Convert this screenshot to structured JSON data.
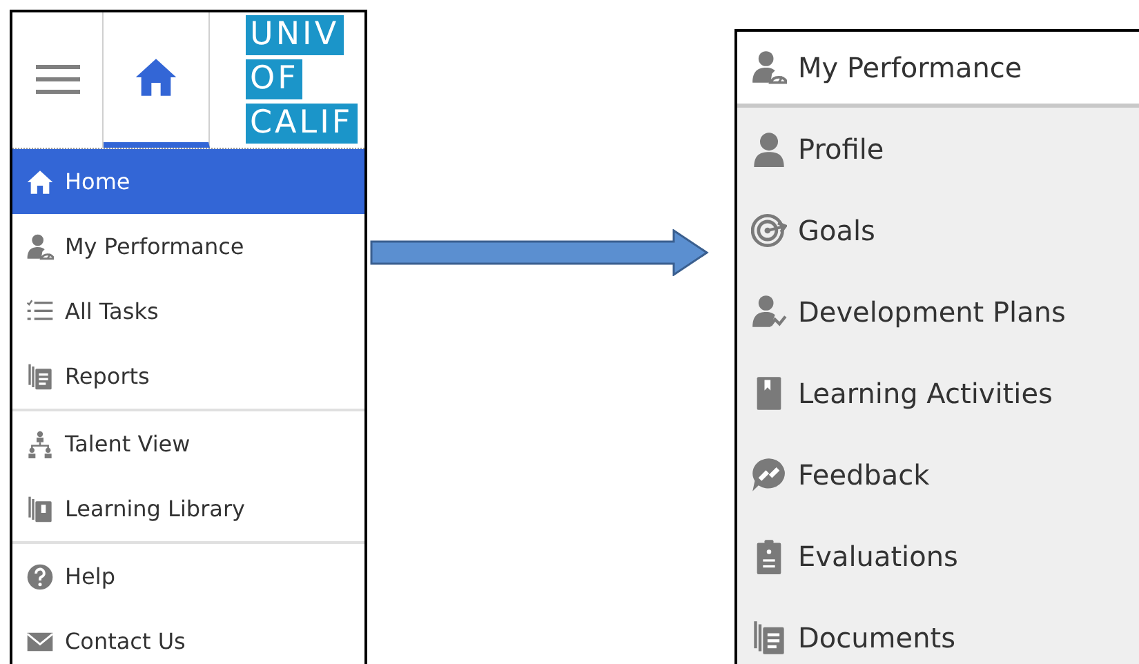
{
  "header": {
    "home_tab": {
      "selected": true
    },
    "logo_lines": [
      "UNIV",
      "OF",
      "CALIF"
    ]
  },
  "nav_sections": [
    {
      "items": [
        {
          "label": "Home",
          "kind": "home",
          "selected": true
        },
        {
          "label": "My Performance",
          "kind": "performance",
          "selected": false
        },
        {
          "label": "All Tasks",
          "kind": "tasks",
          "selected": false
        },
        {
          "label": "Reports",
          "kind": "reports",
          "selected": false
        }
      ]
    },
    {
      "items": [
        {
          "label": "Talent View",
          "kind": "talent",
          "selected": false
        },
        {
          "label": "Learning Library",
          "kind": "library",
          "selected": false
        }
      ]
    },
    {
      "items": [
        {
          "label": "Help",
          "kind": "help",
          "selected": false
        },
        {
          "label": "Contact Us",
          "kind": "mail",
          "selected": false
        }
      ]
    }
  ],
  "submenu": {
    "title": {
      "label": "My Performance",
      "kind": "performance"
    },
    "items": [
      {
        "label": "Profile",
        "kind": "profile"
      },
      {
        "label": "Goals",
        "kind": "goals"
      },
      {
        "label": "Development Plans",
        "kind": "development"
      },
      {
        "label": "Learning Activities",
        "kind": "book"
      },
      {
        "label": "Feedback",
        "kind": "feedback"
      },
      {
        "label": "Evaluations",
        "kind": "clipboard"
      },
      {
        "label": "Documents",
        "kind": "documents"
      }
    ]
  }
}
